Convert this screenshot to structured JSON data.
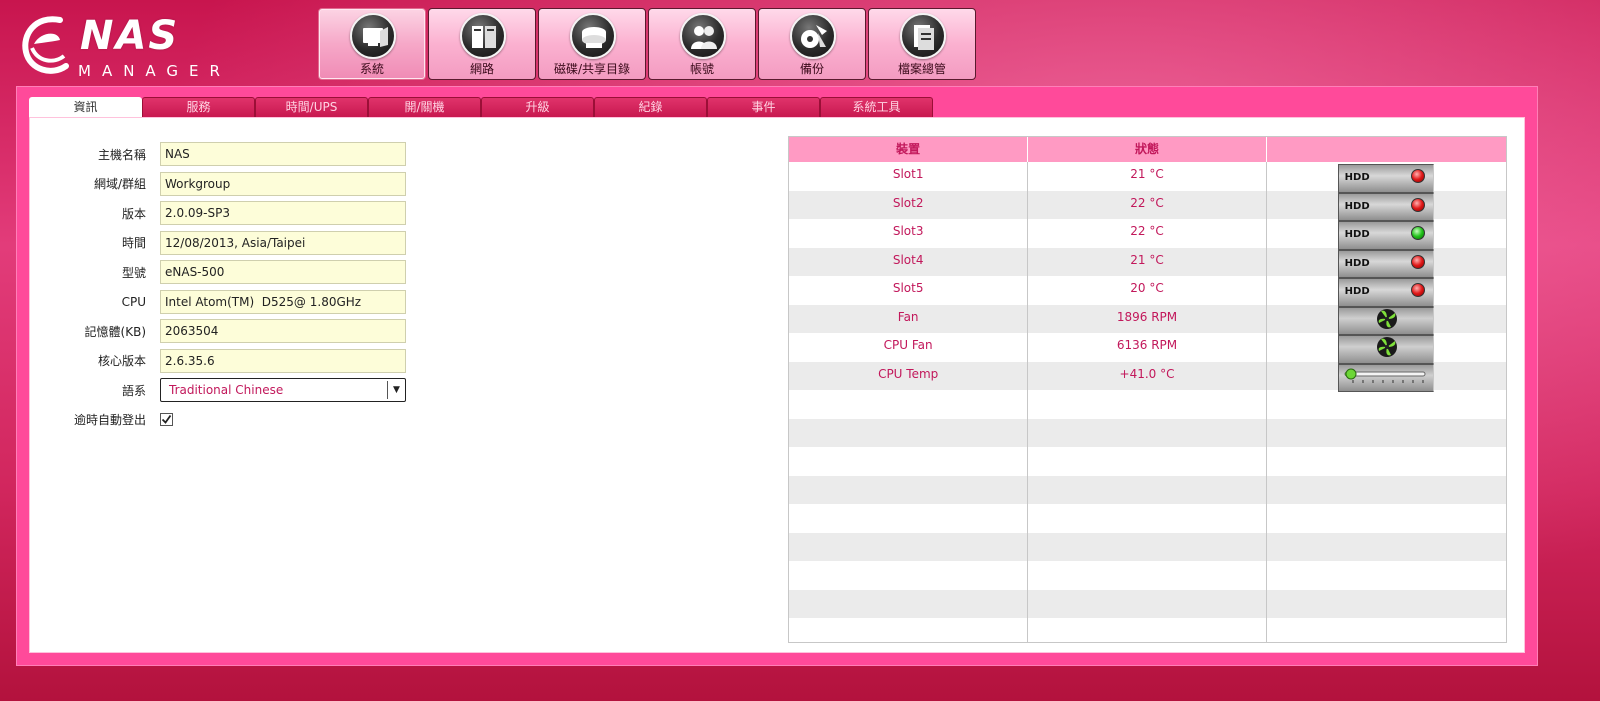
{
  "logo": {
    "word": "eNAS",
    "sub": "MANAGER"
  },
  "topnav": [
    {
      "label": "系統",
      "icon": "system-icon",
      "active": true
    },
    {
      "label": "網路",
      "icon": "network-icon",
      "active": false
    },
    {
      "label": "磁碟/共享目錄",
      "icon": "disk-share-icon",
      "active": false
    },
    {
      "label": "帳號",
      "icon": "accounts-icon",
      "active": false
    },
    {
      "label": "備份",
      "icon": "backup-icon",
      "active": false
    },
    {
      "label": "檔案總管",
      "icon": "file-manager-icon",
      "active": false
    }
  ],
  "tabs": [
    "資訊",
    "服務",
    "時間/UPS",
    "開/關機",
    "升級",
    "紀錄",
    "事件",
    "系統工具"
  ],
  "form": {
    "hostname_label": "主機名稱",
    "hostname_value": "NAS",
    "domain_label": "網域/群組",
    "domain_value": "Workgroup",
    "version_label": "版本",
    "version_value": "2.0.09-SP3",
    "time_label": "時間",
    "time_value": "12/08/2013, Asia/Taipei",
    "model_label": "型號",
    "model_value": "eNAS-500",
    "cpu_label": "CPU",
    "cpu_value": "Intel Atom(TM)  D525@ 1.80GHz",
    "memory_label": "記憶體(KB)",
    "memory_value": "2063504",
    "kernel_label": "核心版本",
    "kernel_value": "2.6.35.6",
    "language_label": "語系",
    "language_value": "Traditional Chinese",
    "autologout_label": "逾時自動登出",
    "autologout_checked": true
  },
  "status_table": {
    "headers": [
      "裝置",
      "狀態",
      ""
    ],
    "rows": [
      {
        "device": "Slot1",
        "status": "21 °C",
        "badge": "hdd",
        "led": "red"
      },
      {
        "device": "Slot2",
        "status": "22 °C",
        "badge": "hdd",
        "led": "red"
      },
      {
        "device": "Slot3",
        "status": "22 °C",
        "badge": "hdd",
        "led": "green"
      },
      {
        "device": "Slot4",
        "status": "21 °C",
        "badge": "hdd",
        "led": "red"
      },
      {
        "device": "Slot5",
        "status": "20 °C",
        "badge": "hdd",
        "led": "red"
      },
      {
        "device": "Fan",
        "status": "1896 RPM",
        "badge": "fan"
      },
      {
        "device": "CPU Fan",
        "status": "6136 RPM",
        "badge": "fan"
      },
      {
        "device": "CPU Temp",
        "status": "+41.0 °C",
        "badge": "temp"
      }
    ],
    "hdd_label": "HDD",
    "empty_rows": 9
  },
  "colors": {
    "accent": "#c2185b",
    "panel": "#ff4a9a",
    "input_bg": "#fdfdd9",
    "header_bg": "#ff9ac3"
  }
}
